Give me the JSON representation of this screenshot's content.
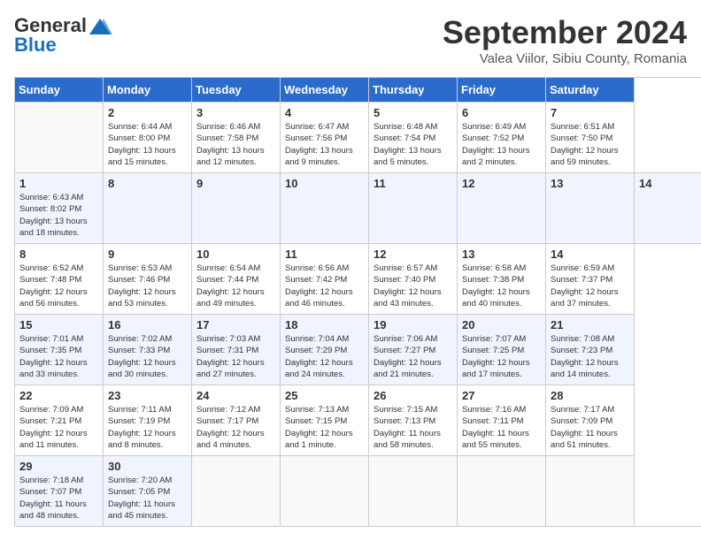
{
  "header": {
    "logo": {
      "general": "General",
      "blue": "Blue"
    },
    "month_title": "September 2024",
    "location": "Valea Viilor, Sibiu County, Romania"
  },
  "calendar": {
    "headers": [
      "Sunday",
      "Monday",
      "Tuesday",
      "Wednesday",
      "Thursday",
      "Friday",
      "Saturday"
    ],
    "weeks": [
      [
        {
          "day": "",
          "info": ""
        },
        {
          "day": "2",
          "info": "Sunrise: 6:44 AM\nSunset: 8:00 PM\nDaylight: 13 hours\nand 15 minutes."
        },
        {
          "day": "3",
          "info": "Sunrise: 6:46 AM\nSunset: 7:58 PM\nDaylight: 13 hours\nand 12 minutes."
        },
        {
          "day": "4",
          "info": "Sunrise: 6:47 AM\nSunset: 7:56 PM\nDaylight: 13 hours\nand 9 minutes."
        },
        {
          "day": "5",
          "info": "Sunrise: 6:48 AM\nSunset: 7:54 PM\nDaylight: 13 hours\nand 5 minutes."
        },
        {
          "day": "6",
          "info": "Sunrise: 6:49 AM\nSunset: 7:52 PM\nDaylight: 13 hours\nand 2 minutes."
        },
        {
          "day": "7",
          "info": "Sunrise: 6:51 AM\nSunset: 7:50 PM\nDaylight: 12 hours\nand 59 minutes."
        }
      ],
      [
        {
          "day": "1",
          "info": "Sunrise: 6:43 AM\nSunset: 8:02 PM\nDaylight: 13 hours\nand 18 minutes."
        },
        {
          "day": "8",
          "info": ""
        },
        {
          "day": "9",
          "info": ""
        },
        {
          "day": "10",
          "info": ""
        },
        {
          "day": "11",
          "info": ""
        },
        {
          "day": "12",
          "info": ""
        },
        {
          "day": "13",
          "info": ""
        },
        {
          "day": "14",
          "info": ""
        }
      ],
      [
        {
          "day": "8",
          "info": "Sunrise: 6:52 AM\nSunset: 7:48 PM\nDaylight: 12 hours\nand 56 minutes."
        },
        {
          "day": "9",
          "info": "Sunrise: 6:53 AM\nSunset: 7:46 PM\nDaylight: 12 hours\nand 53 minutes."
        },
        {
          "day": "10",
          "info": "Sunrise: 6:54 AM\nSunset: 7:44 PM\nDaylight: 12 hours\nand 49 minutes."
        },
        {
          "day": "11",
          "info": "Sunrise: 6:56 AM\nSunset: 7:42 PM\nDaylight: 12 hours\nand 46 minutes."
        },
        {
          "day": "12",
          "info": "Sunrise: 6:57 AM\nSunset: 7:40 PM\nDaylight: 12 hours\nand 43 minutes."
        },
        {
          "day": "13",
          "info": "Sunrise: 6:58 AM\nSunset: 7:38 PM\nDaylight: 12 hours\nand 40 minutes."
        },
        {
          "day": "14",
          "info": "Sunrise: 6:59 AM\nSunset: 7:37 PM\nDaylight: 12 hours\nand 37 minutes."
        }
      ],
      [
        {
          "day": "15",
          "info": "Sunrise: 7:01 AM\nSunset: 7:35 PM\nDaylight: 12 hours\nand 33 minutes."
        },
        {
          "day": "16",
          "info": "Sunrise: 7:02 AM\nSunset: 7:33 PM\nDaylight: 12 hours\nand 30 minutes."
        },
        {
          "day": "17",
          "info": "Sunrise: 7:03 AM\nSunset: 7:31 PM\nDaylight: 12 hours\nand 27 minutes."
        },
        {
          "day": "18",
          "info": "Sunrise: 7:04 AM\nSunset: 7:29 PM\nDaylight: 12 hours\nand 24 minutes."
        },
        {
          "day": "19",
          "info": "Sunrise: 7:06 AM\nSunset: 7:27 PM\nDaylight: 12 hours\nand 21 minutes."
        },
        {
          "day": "20",
          "info": "Sunrise: 7:07 AM\nSunset: 7:25 PM\nDaylight: 12 hours\nand 17 minutes."
        },
        {
          "day": "21",
          "info": "Sunrise: 7:08 AM\nSunset: 7:23 PM\nDaylight: 12 hours\nand 14 minutes."
        }
      ],
      [
        {
          "day": "22",
          "info": "Sunrise: 7:09 AM\nSunset: 7:21 PM\nDaylight: 12 hours\nand 11 minutes."
        },
        {
          "day": "23",
          "info": "Sunrise: 7:11 AM\nSunset: 7:19 PM\nDaylight: 12 hours\nand 8 minutes."
        },
        {
          "day": "24",
          "info": "Sunrise: 7:12 AM\nSunset: 7:17 PM\nDaylight: 12 hours\nand 4 minutes."
        },
        {
          "day": "25",
          "info": "Sunrise: 7:13 AM\nSunset: 7:15 PM\nDaylight: 12 hours\nand 1 minute."
        },
        {
          "day": "26",
          "info": "Sunrise: 7:15 AM\nSunset: 7:13 PM\nDaylight: 11 hours\nand 58 minutes."
        },
        {
          "day": "27",
          "info": "Sunrise: 7:16 AM\nSunset: 7:11 PM\nDaylight: 11 hours\nand 55 minutes."
        },
        {
          "day": "28",
          "info": "Sunrise: 7:17 AM\nSunset: 7:09 PM\nDaylight: 11 hours\nand 51 minutes."
        }
      ],
      [
        {
          "day": "29",
          "info": "Sunrise: 7:18 AM\nSunset: 7:07 PM\nDaylight: 11 hours\nand 48 minutes."
        },
        {
          "day": "30",
          "info": "Sunrise: 7:20 AM\nSunset: 7:05 PM\nDaylight: 11 hours\nand 45 minutes."
        },
        {
          "day": "",
          "info": ""
        },
        {
          "day": "",
          "info": ""
        },
        {
          "day": "",
          "info": ""
        },
        {
          "day": "",
          "info": ""
        },
        {
          "day": "",
          "info": ""
        }
      ]
    ]
  }
}
